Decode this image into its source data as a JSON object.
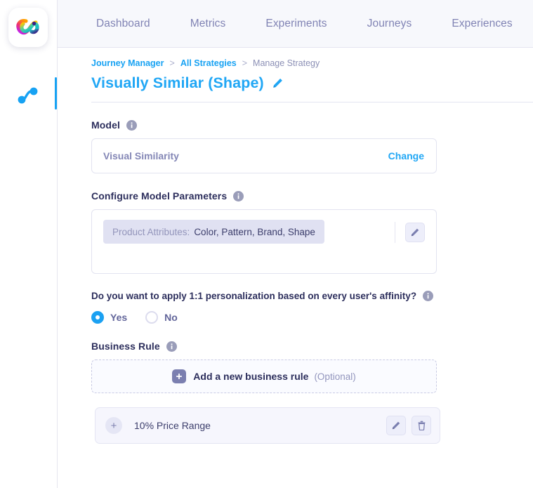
{
  "rail": {
    "logo_name": "brand-logo",
    "items": [
      {
        "id": "journeys",
        "icon": "journey-nodes-icon",
        "active": true
      }
    ]
  },
  "topnav": {
    "items": [
      {
        "label": "Dashboard"
      },
      {
        "label": "Metrics"
      },
      {
        "label": "Experiments"
      },
      {
        "label": "Journeys"
      },
      {
        "label": "Experiences"
      }
    ]
  },
  "breadcrumb": {
    "items": [
      {
        "label": "Journey Manager",
        "current": false
      },
      {
        "label": "All Strategies",
        "current": false
      },
      {
        "label": "Manage Strategy",
        "current": true
      }
    ],
    "separator": ">"
  },
  "page": {
    "title": "Visually Similar (Shape)",
    "title_edit_icon": "pencil-icon"
  },
  "model": {
    "label": "Model",
    "info_icon": "info-icon",
    "name": "Visual Similarity",
    "change_label": "Change"
  },
  "parameters": {
    "label": "Configure Model Parameters",
    "info_icon": "info-icon",
    "chip_key": "Product Attributes:",
    "chip_value": "Color, Pattern, Brand, Shape",
    "edit_icon": "pencil-icon"
  },
  "personalization": {
    "question": "Do you want to apply 1:1 personalization based on every user's affinity?",
    "info_icon": "info-icon",
    "options": [
      {
        "label": "Yes",
        "selected": true
      },
      {
        "label": "No",
        "selected": false
      }
    ]
  },
  "business_rule": {
    "label": "Business Rule",
    "info_icon": "info-icon",
    "add_icon": "plus-square-icon",
    "add_label": "Add a new business rule",
    "add_hint": "(Optional)",
    "rules": [
      {
        "expand_icon": "plus-circle-icon",
        "name": "10% Price Range",
        "edit_icon": "pencil-icon",
        "delete_icon": "trash-icon"
      }
    ]
  },
  "colors": {
    "accent_blue": "#21a7f5",
    "text_dark": "#2c2e5c",
    "muted_purple": "#8487b6",
    "chip_bg": "#e0e1f2",
    "nav_bg": "#f7f8fc"
  }
}
